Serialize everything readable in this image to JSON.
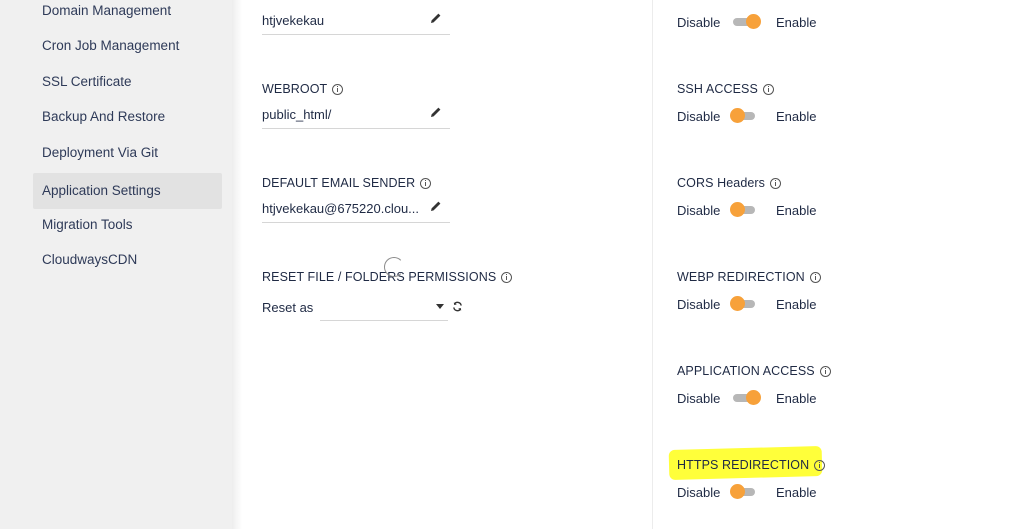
{
  "sidebar": {
    "items": [
      {
        "label": "Domain Management"
      },
      {
        "label": "Cron Job Management"
      },
      {
        "label": "SSL Certificate"
      },
      {
        "label": "Backup And Restore"
      },
      {
        "label": "Deployment Via Git"
      },
      {
        "label": "Application Settings",
        "active": true
      },
      {
        "label": "Migration Tools"
      },
      {
        "label": "CloudwaysCDN"
      }
    ]
  },
  "settings": {
    "username_value": "htjvekekau",
    "webroot": {
      "label": "WEBROOT",
      "value": "public_html/"
    },
    "default_email_sender": {
      "label": "DEFAULT EMAIL SENDER",
      "value": "htjvekekau@675220.clou..."
    },
    "reset_permissions": {
      "label": "RESET FILE / FOLDERS PERMISSIONS",
      "prefix": "Reset as",
      "selected": ""
    }
  },
  "toggles": {
    "disable_label": "Disable",
    "enable_label": "Enable",
    "items": [
      {
        "label": "",
        "state": "enabled"
      },
      {
        "label": "SSH ACCESS",
        "state": "disabled"
      },
      {
        "label": "CORS Headers",
        "state": "disabled"
      },
      {
        "label": "WEBP REDIRECTION",
        "state": "disabled"
      },
      {
        "label": "APPLICATION ACCESS",
        "state": "enabled"
      },
      {
        "label": "HTTPS REDIRECTION",
        "state": "disabled",
        "highlighted": true
      }
    ]
  },
  "colors": {
    "toggle_knob": "#f7a13a",
    "highlight": "#ffff3a"
  }
}
